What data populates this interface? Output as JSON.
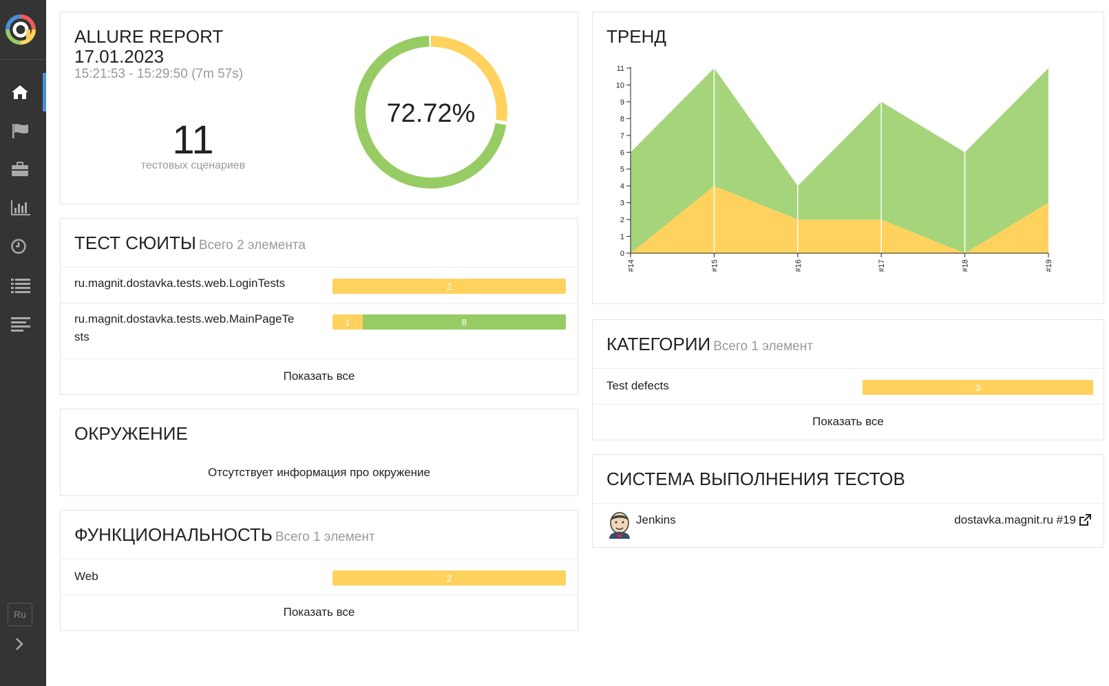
{
  "sidebar": {
    "items": [
      {
        "icon": "home-icon",
        "active": true
      },
      {
        "icon": "flag-icon",
        "active": false
      },
      {
        "icon": "briefcase-icon",
        "active": false
      },
      {
        "icon": "bar-chart-icon",
        "active": false
      },
      {
        "icon": "clock-icon",
        "active": false
      },
      {
        "icon": "list-icon",
        "active": false
      },
      {
        "icon": "align-left-icon",
        "active": false
      }
    ],
    "language": "Ru",
    "accent": "#4a90d9"
  },
  "summary": {
    "title": "ALLURE REPORT",
    "date": "17.01.2023",
    "time_range": "15:21:53 - 15:29:50 (7m 57s)",
    "test_count": "11",
    "test_count_label": "тестовых сценариев",
    "percent": "72.72%",
    "donut": {
      "passed_fraction": 0.7272,
      "broken_fraction": 0.2728,
      "passed_color": "#97cc64",
      "broken_color": "#ffd25e"
    }
  },
  "suites": {
    "title": "ТЕСТ СЮИТЫ",
    "subtitle": "Всего 2 элемента",
    "rows": [
      {
        "name": "ru.magnit.dostavka.tests.web.LoginTests",
        "broken": 2,
        "passed": 0
      },
      {
        "name_line1": "ru.magnit.dostavka.tests.web.MainPageTe",
        "name_line2": "sts",
        "broken": 1,
        "passed": 8
      }
    ],
    "show_all": "Показать все"
  },
  "environment": {
    "title": "ОКРУЖЕНИЕ",
    "empty_text": "Отсутствует информация про окружение"
  },
  "features": {
    "title": "ФУНКЦИОНАЛЬНОСТЬ",
    "subtitle": "Всего 1 элемент",
    "rows": [
      {
        "name": "Web",
        "broken": 2,
        "passed": 0
      }
    ],
    "show_all": "Показать все"
  },
  "trend": {
    "title": "ТРЕНД"
  },
  "chart_data": {
    "type": "area",
    "categories": [
      "#14",
      "#15",
      "#16",
      "#17",
      "#18",
      "#19"
    ],
    "series": [
      {
        "values": [
          0,
          4,
          2,
          2,
          0,
          3
        ],
        "color": "#ffd25e"
      },
      {
        "values": [
          6,
          7,
          2,
          7,
          6,
          8
        ],
        "color": "#97cc64"
      }
    ],
    "stacked": true,
    "ylim": [
      0,
      11
    ],
    "yticks": [
      0,
      1,
      2,
      3,
      4,
      5,
      6,
      7,
      8,
      9,
      10,
      11
    ],
    "xlabel": "",
    "ylabel": ""
  },
  "categories": {
    "title": "КАТЕГОРИИ",
    "subtitle": "Всего 1 элемент",
    "rows": [
      {
        "name": "Test defects",
        "broken": 3,
        "passed": 0
      }
    ],
    "show_all": "Показать все"
  },
  "executors": {
    "title": "СИСТЕМА ВЫПОЛНЕНИЯ ТЕСТОВ",
    "name": "Jenkins",
    "icon": "jenkins-icon",
    "link": "dostavka.magnit.ru #19",
    "link_icon": "external-link-icon"
  }
}
